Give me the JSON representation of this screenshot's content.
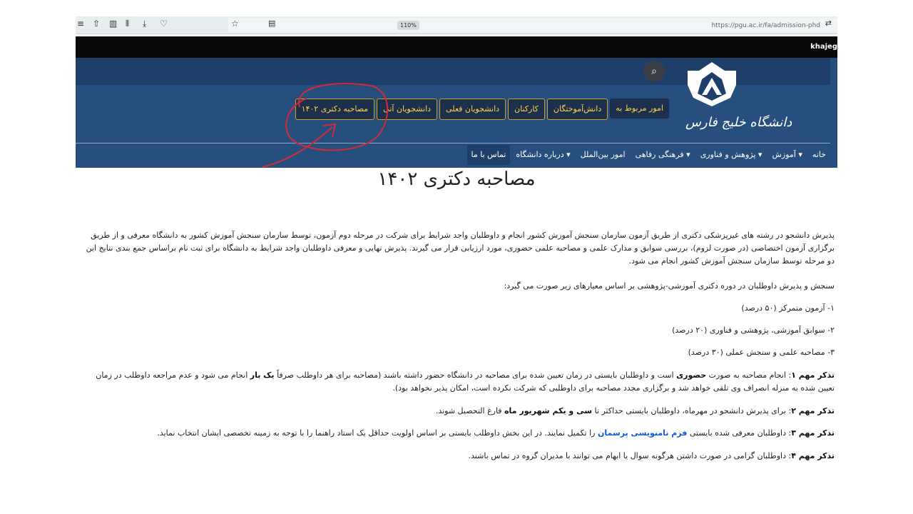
{
  "browser": {
    "zoom": "110%",
    "url": "https://pgu.ac.ir/fa/admission-phd"
  },
  "topbar": {
    "user_text": "khajeg"
  },
  "logo": {
    "text": "دانشگاه خلیج فارس"
  },
  "quicklinks": [
    {
      "label": "امور مربوط به"
    },
    {
      "label": "دانش‌آموختگان"
    },
    {
      "label": "کارکنان"
    },
    {
      "label": "دانشجویان فعلی"
    },
    {
      "label": "دانشجویان آتی"
    },
    {
      "label": "مصاحبه دکتری ۱۴۰۲"
    }
  ],
  "nav": [
    {
      "label": "خانه"
    },
    {
      "label": "آموزش"
    },
    {
      "label": "پژوهش و فناوری"
    },
    {
      "label": "فرهنگی رفاهی"
    },
    {
      "label": "امور بین‌الملل"
    },
    {
      "label": "درباره دانشگاه"
    },
    {
      "label": "تماس با ما"
    }
  ],
  "page": {
    "title": "مصاحبه دکتری ۱۴۰۲",
    "intro": "پذیرش دانشجو در رشته های غیرپزشکی دکتری از طریق آزمون سازمان سنجش آموزش کشور انجام و داوطلبان واجد شرایط برای شرکت در مرحله دوم آزمون، توسط سازمان سنجش آموزش کشور به دانشگاه معرفی و از طریق برگزاری آزمون اختصاصی (در صورت لزوم)، بررسی سوابق و مدارک علمی و مصاحبه علمی حضوری، مورد ارزیابی قرار می گیرند. پذیرش نهایی و معرفی داوطلبان واجد شرایط به دانشگاه برای ثبت نام براساس جمع بندی نتایج این دو مرحله توسط سازمان سنجش آموزش کشور انجام می شود.",
    "criteria_heading": "سنجش و پذیرش داوطلبان در دوره دکتری آموزشی-پژوهشی بر اساس معیارهای زیر صورت می گیرد:",
    "criteria": [
      "۱- آزمون متمرکز (۵۰ درصد)",
      "۲- سوابق آموزشی، پژوهشی و فناوری (۲۰ درصد)",
      "۳- مصاحبه علمی و سنجش عملی (۳۰ درصد)"
    ],
    "note1_label": "تذکر مهم ۱",
    "note1_a": ": انجام مصاحبه به صورت ",
    "note1_b": "حضوری",
    "note1_c": " است و داوطلبان بایستی در زمان تعیین شده برای مصاحبه در دانشگاه حضور داشته باشند (مصاحبه برای هر داوطلب صرفاً ",
    "note1_d": "یک بار",
    "note1_e": " انجام می شود و عدم مراجعه داوطلب در زمان تعیین شده به منزله انصراف وی تلقی خواهد شد و برگزاری مجدد مصاحبه برای داوطلبی که شرکت نکرده است، امکان پذیر نخواهد بود).",
    "note2_label": "تذکر مهم ۲",
    "note2_a": ": برای پذیرش دانشجو در مهرماه، داوطلبان بایستی حداکثر تا ",
    "note2_b": "سی و یکم شهریور ماه",
    "note2_c": " فارغ التحصیل شوند.",
    "note3_label": "تذکر مهم ۳",
    "note3_a": ": داوطلبان معرفی شده بایستی ",
    "note3_link": "فرم نامنویسی پرسمان",
    "note3_c": "  را تکمیل نمایند. در این بخش داوطلب بایستی بر اساس اولویت حداقل یک استاد راهنما را با توجه به زمینه تخصصی ایشان انتخاب نماید.",
    "note4_label": "تذکر مهم ۴",
    "note4_a": ": داوطلبان گرامی در صورت داشتن هرگونه سوال یا ابهام می توانند با مدیران گروه در تماس باشند."
  },
  "colors": {
    "header_blue": "#264f7e",
    "quicklink_text": "#ffd24a",
    "annotation_red": "#d42a3a"
  }
}
